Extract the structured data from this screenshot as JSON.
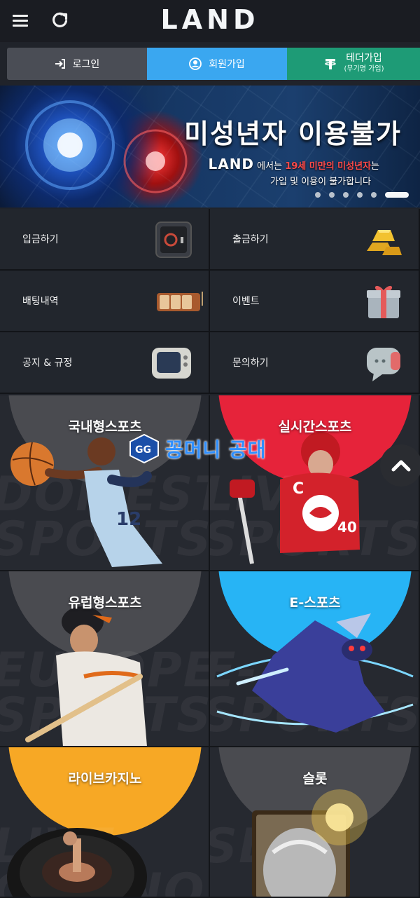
{
  "header": {
    "logo": "LAND",
    "menu_icon": "hamburger-menu-icon",
    "refresh_icon": "refresh-icon"
  },
  "auth": {
    "login_label": "로그인",
    "join_label": "회원가입",
    "tether_label": "테더가입",
    "tether_sub": "(무기명 가입)"
  },
  "banner": {
    "title": "미성년자 이용불가",
    "logo_text": "LAND",
    "line1_pre": "에서는",
    "line1_red": "19세 미만의 미성년자",
    "line1_post": "는",
    "line2": "가입 및 이용이 불가합니다",
    "slides": 6,
    "active_slide": 6
  },
  "menu": {
    "items": [
      {
        "label": "입금하기",
        "icon": "safe-icon"
      },
      {
        "label": "출금하기",
        "icon": "gold-bars-icon"
      },
      {
        "label": "배팅내역",
        "icon": "slot-reels-icon"
      },
      {
        "label": "이벤트",
        "icon": "gift-box-icon"
      },
      {
        "label": "공지 & 규정",
        "icon": "retro-tv-icon"
      },
      {
        "label": "문의하기",
        "icon": "chat-bubble-icon"
      }
    ]
  },
  "games": {
    "tiles": [
      {
        "label": "국내형스포츠",
        "bg_text": "DOMESTIC SPORTS",
        "arc_color": "#4a4b50"
      },
      {
        "label": "실시간스포츠",
        "bg_text": "LIVE SPORTS",
        "arc_color": "#e6233a"
      },
      {
        "label": "유럽형스포츠",
        "bg_text": "EUROPE SPORTS",
        "arc_color": "#4a4b50"
      },
      {
        "label": "E-스포츠",
        "bg_text": "E-SPORTS",
        "arc_color": "#27b4f5"
      },
      {
        "label": "라이브카지노",
        "bg_text": "LIVE CASINO",
        "arc_color": "#f7a825"
      },
      {
        "label": "슬롯",
        "bg_text": "SLOT",
        "arc_color": "#4a4b50"
      }
    ]
  },
  "watermark": {
    "text": "꽁머니 공대"
  },
  "scroll_top_icon": "chevron-up-icon",
  "colors": {
    "join_blue": "#3aa7f0",
    "tether_green": "#1e9b76",
    "login_gray": "#4a4d55",
    "live_red": "#e6233a",
    "esports_cyan": "#27b4f5",
    "casino_orange": "#f7a825"
  }
}
